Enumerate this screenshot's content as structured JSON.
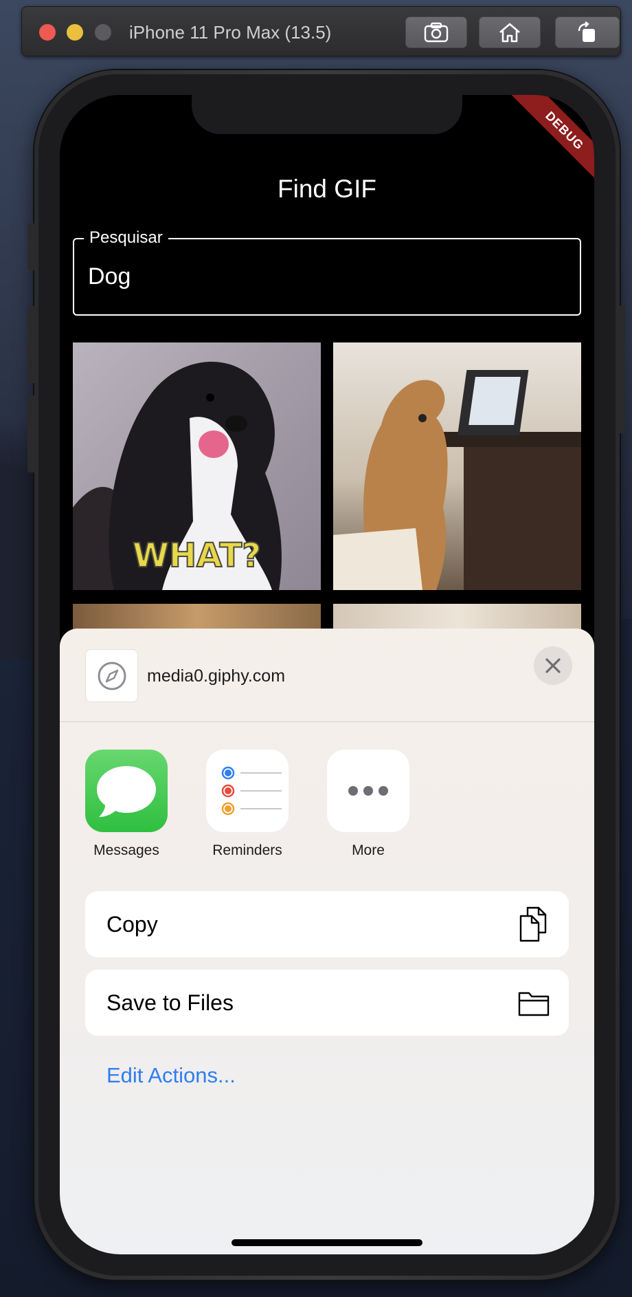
{
  "simulator": {
    "title": "iPhone 11 Pro Max (13.5)",
    "buttons": [
      {
        "name": "screenshot",
        "icon": "camera-icon"
      },
      {
        "name": "home",
        "icon": "home-icon"
      },
      {
        "name": "rotate",
        "icon": "rotate-icon"
      }
    ]
  },
  "app": {
    "title": "Find GIF",
    "debug_banner": "DEBUG",
    "search": {
      "label": "Pesquisar",
      "value": "Dog"
    },
    "gifs": [
      {
        "caption": "WHAT?"
      },
      {
        "caption": ""
      },
      {
        "caption": ""
      },
      {
        "caption": ""
      }
    ]
  },
  "share_sheet": {
    "host": "media0.giphy.com",
    "site_icon": "compass-icon",
    "apps": [
      {
        "label": "Messages",
        "icon": "messages-icon",
        "color": "#34c759"
      },
      {
        "label": "Reminders",
        "icon": "reminders-icon",
        "color": "#ffffff"
      },
      {
        "label": "More",
        "icon": "more-icon",
        "color": "#ffffff"
      }
    ],
    "actions": [
      {
        "label": "Copy",
        "icon": "copy-icon"
      },
      {
        "label": "Save to Files",
        "icon": "folder-icon"
      }
    ],
    "edit_actions": "Edit Actions...",
    "colors": {
      "link": "#2f7ef0",
      "debug": "#8e1d1d"
    }
  }
}
